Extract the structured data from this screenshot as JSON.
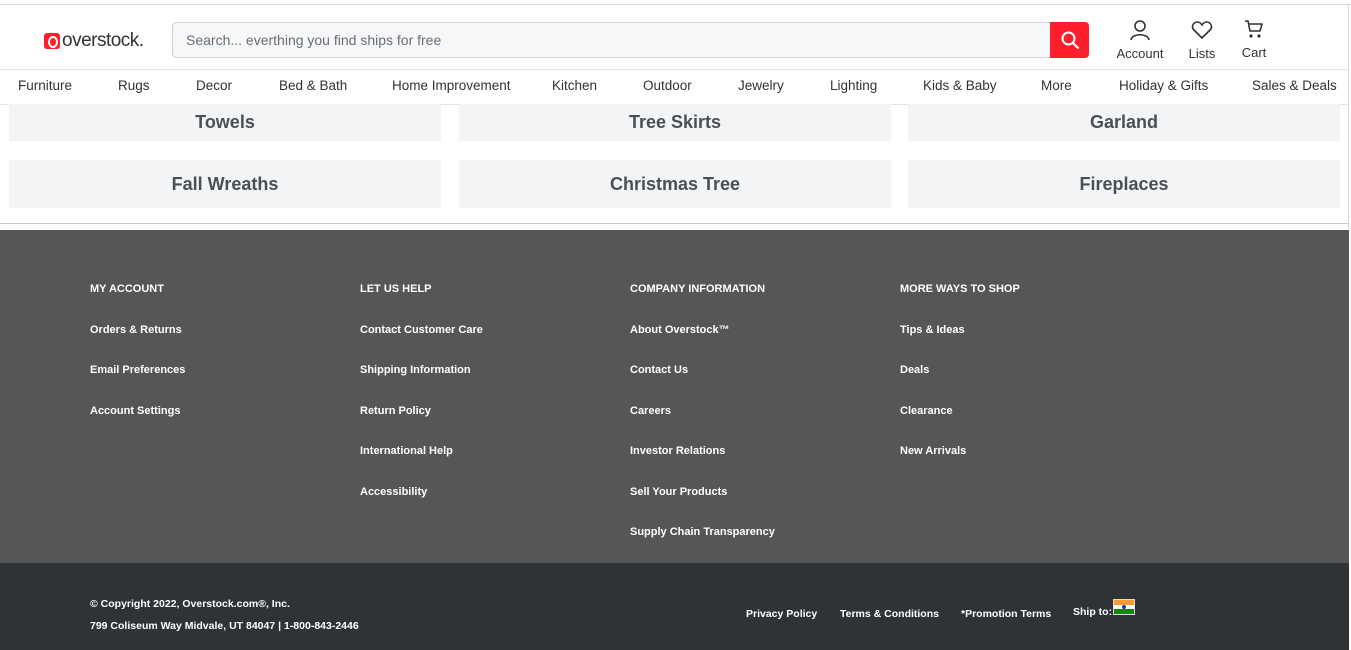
{
  "header": {
    "logo_text": "overstock.",
    "search_placeholder": "Search... everthing you find ships for free",
    "account_label": "Account",
    "lists_label": "Lists",
    "cart_label": "Cart",
    "accent_color": "#ff1f2c"
  },
  "nav": [
    "Furniture",
    "Rugs",
    "Decor",
    "Bed & Bath",
    "Home Improvement",
    "Kitchen",
    "Outdoor",
    "Jewelry",
    "Lighting",
    "Kids & Baby",
    "More",
    "Holiday & Gifts",
    "Sales & Deals"
  ],
  "categories": [
    "Towels",
    "Tree Skirts",
    "Garland",
    "Fall Wreaths",
    "Christmas Tree",
    "Fireplaces"
  ],
  "footer": {
    "columns": [
      {
        "heading": "MY ACCOUNT",
        "links": [
          "Orders & Returns",
          "Email Preferences",
          "Account Settings"
        ]
      },
      {
        "heading": "LET US HELP",
        "links": [
          "Contact Customer Care",
          "Shipping Information",
          "Return Policy",
          "International Help",
          "Accessibility"
        ]
      },
      {
        "heading": "COMPANY INFORMATION",
        "links": [
          "About Overstock™",
          "Contact Us",
          "Careers",
          "Investor Relations",
          "Sell Your Products",
          "Supply Chain Transparency"
        ]
      },
      {
        "heading": "MORE WAYS TO SHOP",
        "links": [
          "Tips & Ideas",
          "Deals",
          "Clearance",
          "New Arrivals"
        ]
      }
    ],
    "copyright": "© Copyright 2022, Overstock.com®, Inc.",
    "address": "799 Coliseum Way Midvale, UT 84047 | 1-800-843-2446",
    "privacy": "Privacy Policy",
    "terms": "Terms & Conditions",
    "promo_terms": "*Promotion Terms",
    "ship_to": "Ship to:",
    "ship_to_flag": "india-flag-icon"
  }
}
